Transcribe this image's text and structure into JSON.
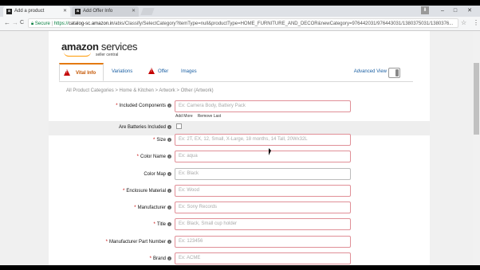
{
  "browser": {
    "tabs": [
      {
        "favicon": "a",
        "title": "Add a product",
        "active": true
      },
      {
        "favicon": "a",
        "title": "Add Offer Info",
        "active": false
      }
    ],
    "url_secure_label": "Secure",
    "url_prefix": "https://",
    "url_host": "catalog-sc.amazon.in",
    "url_path": "/abis/Classify/SelectCategory?itemType=null&productType=HOME_FURNITURE_AND_DECOR&newCategory=976442031/976443031/1380375031/1380376...",
    "controls": {
      "minimize": "–",
      "maximize": "□",
      "close": "✕",
      "back": "←",
      "forward": "→",
      "reload": "C",
      "star": "☆",
      "menu": "⋮",
      "download": "⬇"
    }
  },
  "logo": {
    "brand": "amazon",
    "suffix": "services",
    "subtitle": "seller central"
  },
  "tabs": [
    {
      "label": "Vital Info",
      "active": true,
      "warning": true
    },
    {
      "label": "Variations",
      "active": false,
      "warning": false
    },
    {
      "label": "Offer",
      "active": false,
      "warning": true
    },
    {
      "label": "Images",
      "active": false,
      "warning": false
    }
  ],
  "advanced_view": "Advanced View",
  "breadcrumb": "All Product Categories > Home & Kitchen > Artwork > Other (Artwork)",
  "add_more": "Add More",
  "remove_last": "Remove Last",
  "fields": [
    {
      "label": "Included Components",
      "required": true,
      "placeholder": "Ex: Camera Body, Battery Pack",
      "type": "text",
      "state": "error"
    },
    {
      "label": "Are Batteries Included",
      "required": false,
      "placeholder": "",
      "type": "checkbox",
      "state": ""
    },
    {
      "label": "Size",
      "required": true,
      "placeholder": "Ex: 2T, EX, 12, Small, X-Large, 18 months, 14 Tall, 20Wx32L",
      "type": "text",
      "state": "error"
    },
    {
      "label": "Color Name",
      "required": true,
      "placeholder": "Ex: aqua",
      "type": "text",
      "state": "error"
    },
    {
      "label": "Color Map",
      "required": false,
      "placeholder": "Ex: Black",
      "type": "text",
      "state": "plain"
    },
    {
      "label": "Enclosure Material",
      "required": true,
      "placeholder": "Ex: Wood",
      "type": "text",
      "state": "error"
    },
    {
      "label": "Manufacturer",
      "required": true,
      "placeholder": "Ex: Sony Records",
      "type": "text",
      "state": "error"
    },
    {
      "label": "Title",
      "required": true,
      "placeholder": "Ex: Black, Small cup holder",
      "type": "text",
      "state": "error"
    },
    {
      "label": "Manufacturer Part Number",
      "required": true,
      "placeholder": "Ex: 123456",
      "type": "text",
      "state": "error"
    },
    {
      "label": "Brand",
      "required": true,
      "placeholder": "Ex: ACME",
      "type": "text",
      "state": "error"
    }
  ],
  "icons": {
    "info": "info-icon",
    "warning": "warning-icon"
  },
  "colors": {
    "accent": "#e47911",
    "error_border": "#e08f97",
    "link": "#1a5fa3",
    "required": "#c40000"
  }
}
